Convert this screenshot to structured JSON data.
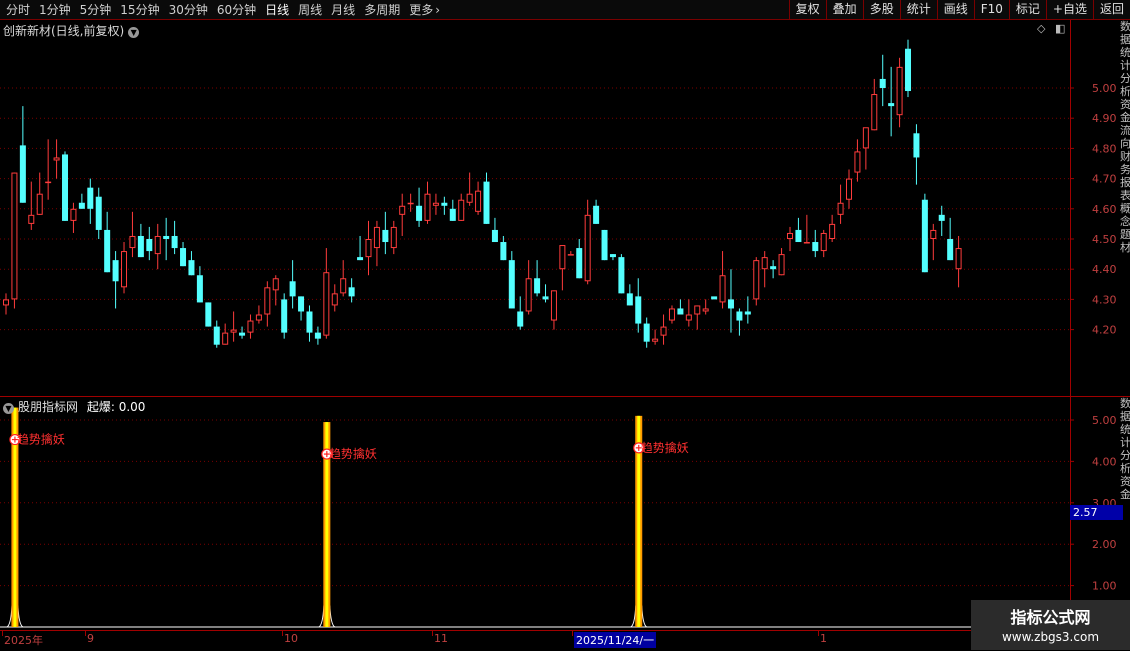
{
  "toolbar": {
    "periods": [
      "分时",
      "1分钟",
      "5分钟",
      "15分钟",
      "30分钟",
      "60分钟",
      "日线",
      "周线",
      "月线",
      "多周期",
      "更多"
    ],
    "active_period": "日线",
    "more_arrow": "›",
    "right_buttons": [
      "复权",
      "叠加",
      "多股",
      "统计",
      "画线",
      "F10",
      "标记",
      "+自选",
      "返回"
    ]
  },
  "chart": {
    "title": "创新新材(日线,前复权)",
    "price_ticks": [
      "5.00",
      "4.90",
      "4.80",
      "4.70",
      "4.60",
      "4.50",
      "4.40",
      "4.30",
      "4.20"
    ],
    "price_ylim": [
      4.1,
      5.15
    ]
  },
  "indicator": {
    "name": "股朋指标网",
    "label": "起爆:",
    "value": "0.00",
    "ticks": [
      "5.00",
      "4.00",
      "3.00",
      "2.00",
      "1.00"
    ],
    "current_value": "2.57",
    "signal_text": "趋势擒妖",
    "ylim": [
      0,
      5.4
    ]
  },
  "date_axis": {
    "labels": [
      "2025年",
      "9",
      "10",
      "11",
      "2025/11/24/一",
      "1"
    ],
    "highlight": "2025/11/24/一"
  },
  "watermark": {
    "line1": "指标公式网",
    "line2": "www.zbgs3.com"
  },
  "right_strip_text": "数据统计分析资金流向财务报表概念题材",
  "right_strip_text2": "数据统计分析资金",
  "colors": {
    "up": "#ff3c3c",
    "down": "#54ffff",
    "grid": "#7a0000",
    "axis": "#a00000",
    "signal_outer": "#ff9900",
    "signal_inner": "#ffff00"
  },
  "chart_data": {
    "type": "candlestick",
    "title": "创新新材(日线,前复权)",
    "ylim": [
      4.1,
      5.15
    ],
    "candles": [
      [
        4.28,
        4.32,
        4.25,
        4.3
      ],
      [
        4.3,
        4.72,
        4.27,
        4.72
      ],
      [
        4.81,
        4.94,
        4.62,
        4.62
      ],
      [
        4.55,
        4.69,
        4.53,
        4.58
      ],
      [
        4.58,
        4.72,
        4.58,
        4.65
      ],
      [
        4.69,
        4.83,
        4.63,
        4.69
      ],
      [
        4.76,
        4.83,
        4.7,
        4.77
      ],
      [
        4.78,
        4.79,
        4.56,
        4.56
      ],
      [
        4.56,
        4.62,
        4.52,
        4.6
      ],
      [
        4.62,
        4.65,
        4.6,
        4.6
      ],
      [
        4.67,
        4.7,
        4.55,
        4.6
      ],
      [
        4.64,
        4.67,
        4.5,
        4.53
      ],
      [
        4.53,
        4.59,
        4.39,
        4.39
      ],
      [
        4.43,
        4.46,
        4.27,
        4.36
      ],
      [
        4.34,
        4.49,
        4.32,
        4.46
      ],
      [
        4.47,
        4.59,
        4.44,
        4.51
      ],
      [
        4.51,
        4.55,
        4.44,
        4.44
      ],
      [
        4.5,
        4.54,
        4.43,
        4.46
      ],
      [
        4.45,
        4.55,
        4.4,
        4.51
      ],
      [
        4.51,
        4.57,
        4.43,
        4.5
      ],
      [
        4.51,
        4.56,
        4.45,
        4.47
      ],
      [
        4.47,
        4.49,
        4.41,
        4.41
      ],
      [
        4.43,
        4.46,
        4.38,
        4.38
      ],
      [
        4.38,
        4.41,
        4.29,
        4.29
      ],
      [
        4.29,
        4.29,
        4.21,
        4.21
      ],
      [
        4.21,
        4.23,
        4.14,
        4.15
      ],
      [
        4.15,
        4.22,
        4.15,
        4.19
      ],
      [
        4.19,
        4.26,
        4.16,
        4.2
      ],
      [
        4.19,
        4.21,
        4.17,
        4.18
      ],
      [
        4.19,
        4.25,
        4.17,
        4.23
      ],
      [
        4.23,
        4.28,
        4.22,
        4.25
      ],
      [
        4.25,
        4.36,
        4.21,
        4.34
      ],
      [
        4.33,
        4.38,
        4.28,
        4.37
      ],
      [
        4.3,
        4.32,
        4.17,
        4.19
      ],
      [
        4.36,
        4.43,
        4.27,
        4.31
      ],
      [
        4.31,
        4.31,
        4.23,
        4.26
      ],
      [
        4.26,
        4.28,
        4.16,
        4.19
      ],
      [
        4.19,
        4.21,
        4.15,
        4.17
      ],
      [
        4.18,
        4.47,
        4.17,
        4.39
      ],
      [
        4.28,
        4.35,
        4.26,
        4.32
      ],
      [
        4.32,
        4.43,
        4.31,
        4.37
      ],
      [
        4.34,
        4.37,
        4.29,
        4.31
      ],
      [
        4.44,
        4.51,
        4.43,
        4.43
      ],
      [
        4.44,
        4.56,
        4.38,
        4.5
      ],
      [
        4.47,
        4.56,
        4.41,
        4.54
      ],
      [
        4.53,
        4.59,
        4.45,
        4.49
      ],
      [
        4.47,
        4.56,
        4.45,
        4.54
      ],
      [
        4.58,
        4.65,
        4.51,
        4.61
      ],
      [
        4.62,
        4.65,
        4.59,
        4.62
      ],
      [
        4.61,
        4.67,
        4.54,
        4.56
      ],
      [
        4.56,
        4.69,
        4.55,
        4.65
      ],
      [
        4.61,
        4.65,
        4.58,
        4.62
      ],
      [
        4.62,
        4.64,
        4.58,
        4.61
      ],
      [
        4.6,
        4.63,
        4.56,
        4.56
      ],
      [
        4.56,
        4.65,
        4.56,
        4.63
      ],
      [
        4.62,
        4.72,
        4.61,
        4.65
      ],
      [
        4.59,
        4.69,
        4.58,
        4.66
      ],
      [
        4.69,
        4.72,
        4.55,
        4.55
      ],
      [
        4.53,
        4.57,
        4.49,
        4.49
      ],
      [
        4.49,
        4.51,
        4.43,
        4.43
      ],
      [
        4.43,
        4.46,
        4.27,
        4.27
      ],
      [
        4.26,
        4.31,
        4.2,
        4.21
      ],
      [
        4.26,
        4.43,
        4.25,
        4.37
      ],
      [
        4.37,
        4.43,
        4.31,
        4.32
      ],
      [
        4.31,
        4.35,
        4.29,
        4.3
      ],
      [
        4.23,
        4.33,
        4.2,
        4.33
      ],
      [
        4.4,
        4.45,
        4.33,
        4.48
      ],
      [
        4.45,
        4.46,
        4.45,
        4.45
      ],
      [
        4.47,
        4.5,
        4.37,
        4.37
      ],
      [
        4.36,
        4.63,
        4.35,
        4.58
      ],
      [
        4.61,
        4.63,
        4.55,
        4.55
      ],
      [
        4.53,
        4.53,
        4.43,
        4.43
      ],
      [
        4.45,
        4.45,
        4.43,
        4.44
      ],
      [
        4.44,
        4.45,
        4.32,
        4.32
      ],
      [
        4.32,
        4.35,
        4.28,
        4.28
      ],
      [
        4.31,
        4.37,
        4.19,
        4.22
      ],
      [
        4.22,
        4.24,
        4.14,
        4.16
      ],
      [
        4.16,
        4.2,
        4.15,
        4.17
      ],
      [
        4.18,
        4.25,
        4.15,
        4.21
      ],
      [
        4.23,
        4.28,
        4.22,
        4.27
      ],
      [
        4.27,
        4.3,
        4.25,
        4.25
      ],
      [
        4.23,
        4.3,
        4.21,
        4.25
      ],
      [
        4.25,
        4.28,
        4.2,
        4.28
      ],
      [
        4.26,
        4.3,
        4.25,
        4.27
      ],
      [
        4.31,
        4.3,
        4.3,
        4.3
      ],
      [
        4.29,
        4.46,
        4.27,
        4.38
      ],
      [
        4.3,
        4.4,
        4.19,
        4.27
      ],
      [
        4.26,
        4.27,
        4.18,
        4.23
      ],
      [
        4.26,
        4.31,
        4.22,
        4.25
      ],
      [
        4.3,
        4.44,
        4.28,
        4.43
      ],
      [
        4.4,
        4.46,
        4.34,
        4.44
      ],
      [
        4.41,
        4.43,
        4.37,
        4.4
      ],
      [
        4.38,
        4.47,
        4.38,
        4.45
      ],
      [
        4.5,
        4.54,
        4.46,
        4.52
      ],
      [
        4.53,
        4.57,
        4.49,
        4.49
      ],
      [
        4.49,
        4.58,
        4.49,
        4.49
      ],
      [
        4.49,
        4.53,
        4.44,
        4.46
      ],
      [
        4.46,
        4.53,
        4.44,
        4.52
      ],
      [
        4.5,
        4.58,
        4.49,
        4.55
      ],
      [
        4.58,
        4.68,
        4.55,
        4.62
      ],
      [
        4.63,
        4.73,
        4.6,
        4.7
      ],
      [
        4.72,
        4.83,
        4.69,
        4.79
      ],
      [
        4.8,
        4.86,
        4.73,
        4.87
      ],
      [
        4.86,
        5.03,
        4.86,
        4.98
      ],
      [
        5.03,
        5.11,
        4.94,
        5.0
      ],
      [
        4.95,
        5.07,
        4.84,
        4.94
      ],
      [
        4.91,
        5.1,
        4.87,
        5.07
      ],
      [
        5.13,
        5.16,
        4.97,
        4.99
      ],
      [
        4.85,
        4.88,
        4.68,
        4.77
      ],
      [
        4.63,
        4.65,
        4.39,
        4.39
      ],
      [
        4.5,
        4.55,
        4.43,
        4.53
      ],
      [
        4.58,
        4.61,
        4.51,
        4.56
      ],
      [
        4.5,
        4.57,
        4.43,
        4.43
      ],
      [
        4.4,
        4.51,
        4.34,
        4.47
      ]
    ],
    "signals": [
      {
        "index": 1,
        "value": 5.3
      },
      {
        "index": 38,
        "value": 4.95
      },
      {
        "index": 75,
        "value": 5.1
      }
    ]
  }
}
